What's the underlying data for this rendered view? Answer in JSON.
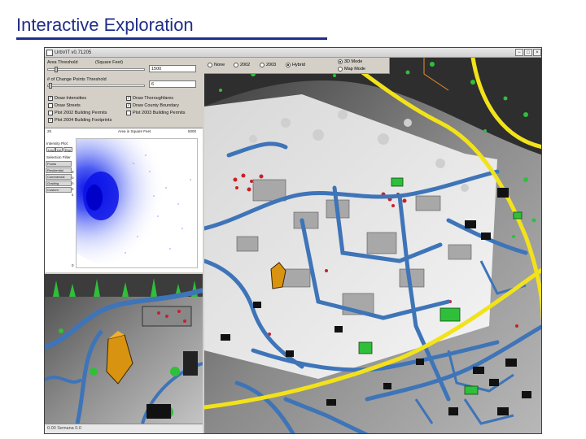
{
  "slide": {
    "title": "Interactive Exploration"
  },
  "window": {
    "title": "UrbVIT v0.71205",
    "buttons": {
      "minimize": "−",
      "maximize": "□",
      "close": "×"
    }
  },
  "controls": {
    "area_threshold_label": "Area Threshold",
    "area_threshold_unit": "(Square Feet)",
    "area_threshold_value": "1500",
    "change_points_label": "# of Change Points Threshold",
    "change_points_value": "6",
    "checkboxes": [
      {
        "label": "Draw Intensities",
        "checked": true
      },
      {
        "label": "Draw Thoroughfares",
        "checked": true
      },
      {
        "label": "Draw Streets",
        "checked": false
      },
      {
        "label": "Draw County Boundary",
        "checked": true
      },
      {
        "label": "Plot 2002 Building Permits",
        "checked": false
      },
      {
        "label": "Plot 2003 Building Permits",
        "checked": false
      },
      {
        "label": "Plot 2004 Building Footprints",
        "checked": true
      }
    ],
    "year_radios": [
      {
        "label": "None",
        "selected": false
      },
      {
        "label": "2002",
        "selected": false
      },
      {
        "label": "2003",
        "selected": false
      },
      {
        "label": "Hybrid",
        "selected": true
      }
    ],
    "view_modes": [
      {
        "label": "3D Mode",
        "selected": true
      },
      {
        "label": "Map Mode",
        "selected": false
      }
    ]
  },
  "scatter": {
    "axis_min": "25",
    "x_label": "Area in Square Feet",
    "axis_max": "5000",
    "y_min": "0",
    "intensity_label": "Intensity Plot:",
    "scale_buttons": [
      "Log",
      "Lin",
      "Exp"
    ],
    "selection_label": "Selection Filter",
    "filters": [
      "Points",
      "Residential",
      "Commercial",
      "Grading",
      "Custom"
    ],
    "y_label": "Z o n e s"
  },
  "status": {
    "text": "0.00 Semana 0.0"
  },
  "colors": {
    "title_blue": "#1f2e88",
    "scatter_blue": "#1a2cf0",
    "road_blue": "#3e74b8",
    "highway_yellow": "#f2e21a",
    "permit_red": "#c8202a",
    "vegetation_green": "#2fbf3a",
    "highlight_orange": "#d89410"
  }
}
